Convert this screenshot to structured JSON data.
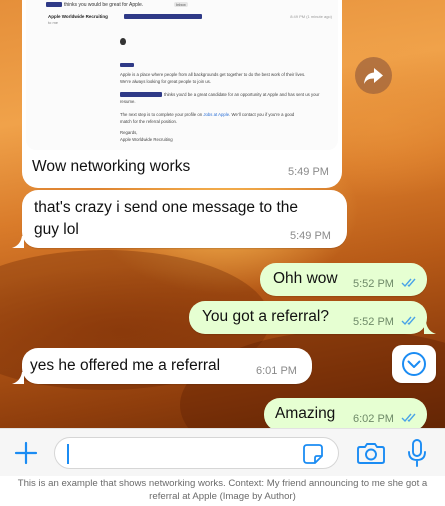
{
  "email_preview": {
    "subject": "thinks you would be great for Apple.",
    "badge": "Inbox",
    "sender": "Apple Worldwide Recruiting",
    "recipient": "to me",
    "date": "8:49 PM (1 minute ago)",
    "body_line_1": "Apple is a place where people from all backgrounds get together to do the best work of their lives.",
    "body_line_2": "We're always looking for great people to join us.",
    "body_line_3": "thinks you'd be a great candidate for an opportunity at Apple and has sent us your",
    "body_line_4": "resume.",
    "body_line_5a": "The next step is to complete your profile on ",
    "body_line_5_link": "Jobs at Apple",
    "body_line_5b": ". We'll contact you if you're a good",
    "body_line_6": "match for the referral position.",
    "signoff_1": "Regards,",
    "signoff_2": "Apple Worldwide Recruiting"
  },
  "messages": [
    {
      "direction": "incoming",
      "text": "Wow networking works",
      "time": "5:49 PM"
    },
    {
      "direction": "incoming",
      "text_line_1": "that's crazy i send one message to the",
      "text_line_2": "guy lol",
      "time": "5:49 PM"
    },
    {
      "direction": "outgoing",
      "text": "Ohh wow",
      "time": "5:52 PM",
      "read": true
    },
    {
      "direction": "outgoing",
      "text": "You got a referral?",
      "time": "5:52 PM",
      "read": true
    },
    {
      "direction": "incoming",
      "text": "yes he offered me a referral",
      "time": "6:01 PM"
    },
    {
      "direction": "outgoing",
      "text": "Amazing",
      "time": "6:02 PM",
      "read": true
    }
  ],
  "icons": {
    "forward": "forward-arrow-icon",
    "scroll_down": "chevron-down-icon",
    "attach": "plus-icon",
    "sticker": "sticker-icon",
    "camera": "camera-icon",
    "microphone": "microphone-icon"
  },
  "colors": {
    "accent": "#1b8cf3",
    "outgoing_bubble": "#e6ffd2",
    "incoming_bubble": "#ffffff",
    "read_ticks": "#4aa3e8"
  },
  "message_input": {
    "value": ""
  },
  "caption": "This is an example that shows networking works. Context: My friend announcing to me she got a referral at Apple (Image by Author)"
}
